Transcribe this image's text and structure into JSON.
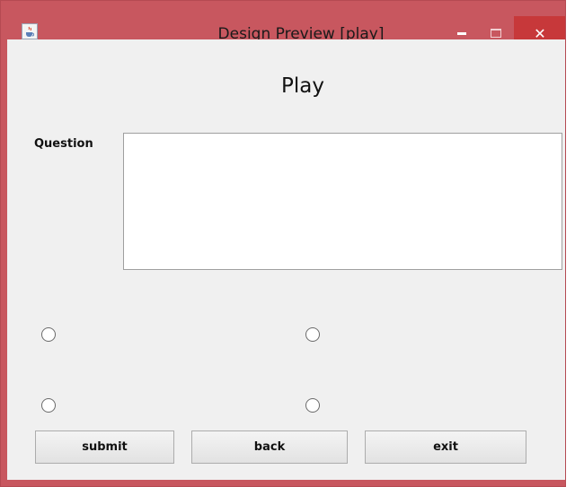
{
  "window": {
    "title": "Design Preview [play]",
    "close_glyph": "✕",
    "accent_color": "#c8575f",
    "close_color": "#c7383a"
  },
  "form": {
    "heading": "Play",
    "question_label": "Question",
    "question_value": ""
  },
  "options": [
    {
      "label": "",
      "checked": false
    },
    {
      "label": "",
      "checked": false
    },
    {
      "label": "",
      "checked": false
    },
    {
      "label": "",
      "checked": false
    }
  ],
  "buttons": {
    "submit": "submit",
    "back": "back",
    "exit": "exit"
  }
}
